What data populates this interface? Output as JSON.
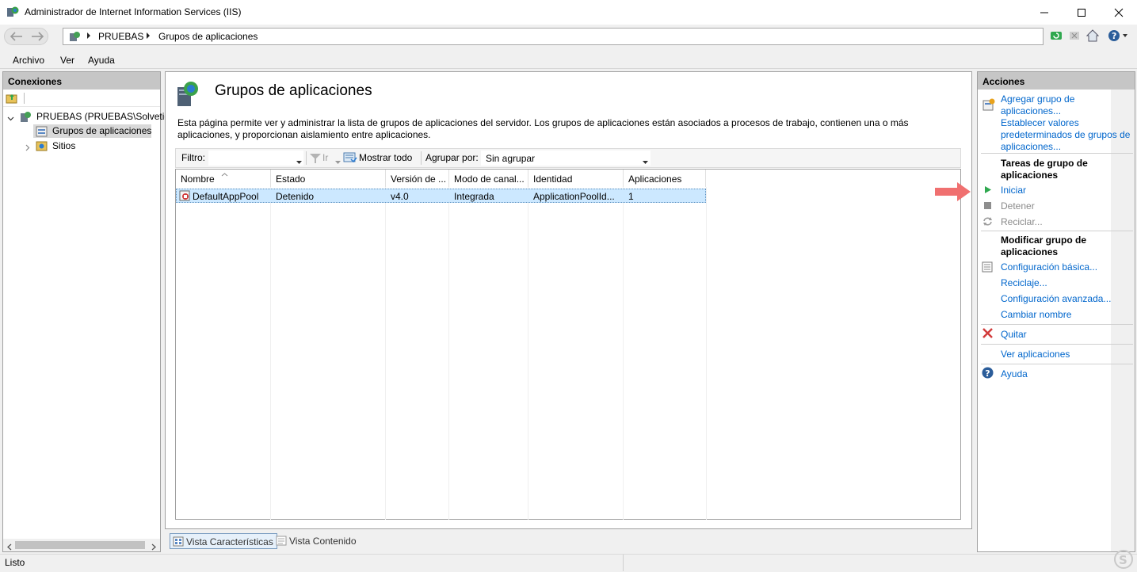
{
  "window": {
    "title": "Administrador de Internet Information Services (IIS)"
  },
  "address": {
    "crumbs": [
      "PRUEBAS",
      "Grupos de aplicaciones"
    ]
  },
  "menu": {
    "items": [
      "Archivo",
      "Ver",
      "Ayuda"
    ]
  },
  "connections": {
    "header": "Conexiones",
    "tree": [
      {
        "label": "PRUEBAS (PRUEBAS\\Solvetic)",
        "icon": "server-icon"
      },
      {
        "label": "Grupos de aplicaciones",
        "icon": "app-pools-icon",
        "selected": true
      },
      {
        "label": "Sitios",
        "icon": "sites-icon"
      }
    ]
  },
  "main": {
    "title": "Grupos de aplicaciones",
    "description": "Esta página permite ver y administrar la lista de grupos de aplicaciones del servidor. Los grupos de aplicaciones están asociados a procesos de trabajo, contienen una o más aplicaciones, y proporcionan aislamiento entre aplicaciones.",
    "filter": {
      "label": "Filtro:",
      "value": "",
      "go_label": "Ir",
      "show_all_label": "Mostrar todo",
      "group_label": "Agrupar por:",
      "group_value": "Sin agrupar"
    },
    "columns": [
      "Nombre",
      "Estado",
      "Versión de ...",
      "Modo de canal...",
      "Identidad",
      "Aplicaciones"
    ],
    "rows": [
      {
        "name": "DefaultAppPool",
        "state": "Detenido",
        "version": "v4.0",
        "mode": "Integrada",
        "identity": "ApplicationPoolId...",
        "apps": "1"
      }
    ],
    "tabs": [
      "Vista Características",
      "Vista Contenido"
    ]
  },
  "actions": {
    "header": "Acciones",
    "add_pool": "Agregar grupo de aplicaciones...",
    "set_defaults": "Establecer valores predeterminados de grupos de aplicaciones...",
    "tasks_header": "Tareas de grupo de aplicaciones",
    "start": "Iniciar",
    "stop": "Detener",
    "recycle": "Reciclar...",
    "modify_header": "Modificar grupo de aplicaciones",
    "basic": "Configuración básica...",
    "recycling": "Reciclaje...",
    "advanced": "Configuración avanzada...",
    "rename": "Cambiar nombre",
    "remove": "Quitar",
    "view_apps": "Ver aplicaciones",
    "help": "Ayuda"
  },
  "status": {
    "text": "Listo"
  },
  "colors": {
    "link": "#0066cc",
    "selection": "#cce8ff",
    "panel_header": "#c6c6c6",
    "arrow": "#f07070"
  }
}
